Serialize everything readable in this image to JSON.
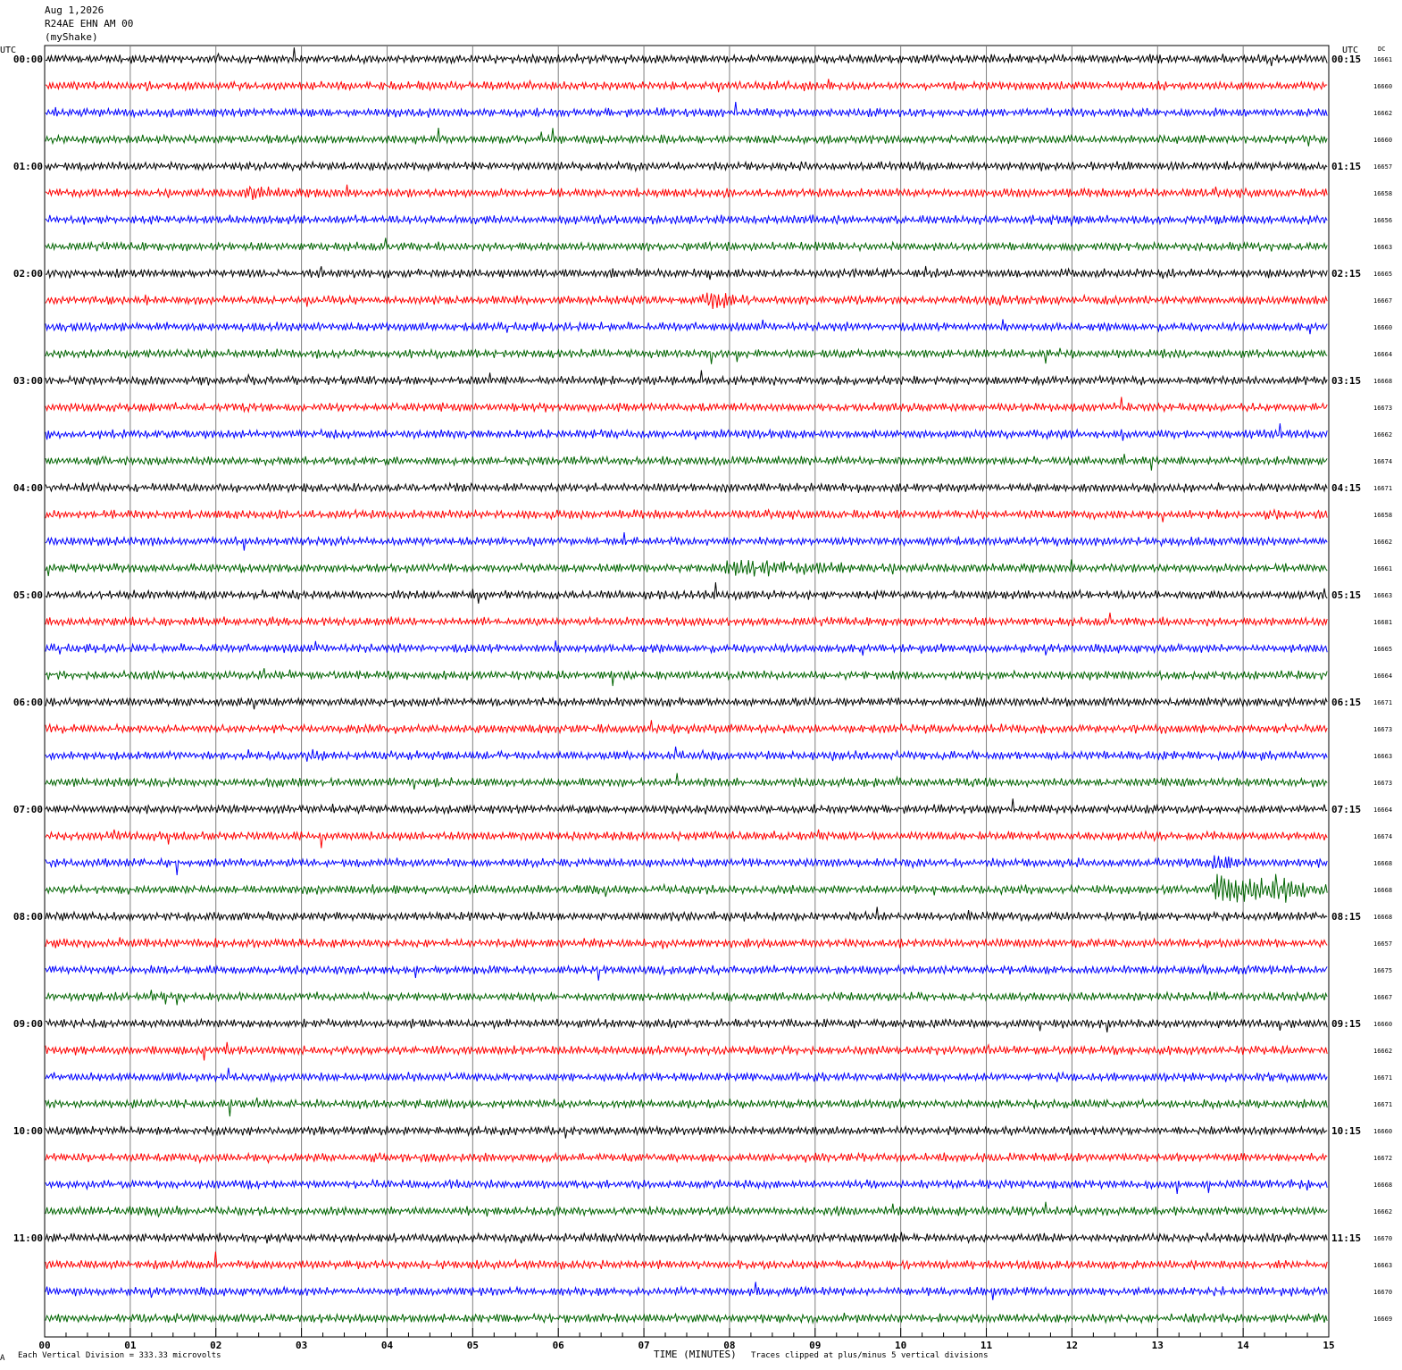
{
  "header": {
    "date": "Aug 1,2026",
    "station": "R24AE EHN AM 00",
    "network": "(myShake)"
  },
  "footer": {
    "scale_note": "Each Vertical Division =  333.33 microvolts",
    "clip_note": "Traces clipped at plus/minus 5 vertical divisions",
    "small_mark": "A"
  },
  "colors": {
    "trace_cycle": [
      "#000000",
      "#ff0000",
      "#0000ff",
      "#006400"
    ],
    "grid": "#808080"
  },
  "chart_data": {
    "type": "line",
    "subtype": "helicorder",
    "xlabel": "TIME (MINUTES)",
    "xlim": [
      0,
      15
    ],
    "x_ticks": [
      "00",
      "01",
      "02",
      "03",
      "04",
      "05",
      "06",
      "07",
      "08",
      "09",
      "10",
      "11",
      "12",
      "13",
      "14",
      "15"
    ],
    "left_axis_title": "UTC",
    "right_axis_title": "UTC",
    "dc_title": "DC",
    "row_minutes": 15,
    "row_labels_left": [
      "00:00",
      "",
      "",
      "",
      "01:00",
      "",
      "",
      "",
      "02:00",
      "",
      "",
      "",
      "03:00",
      "",
      "",
      "",
      "04:00",
      "",
      "",
      "",
      "05:00",
      "",
      "",
      "",
      "06:00",
      "",
      "",
      "",
      "07:00",
      "",
      "",
      "",
      "08:00",
      "",
      "",
      "",
      "09:00",
      "",
      "",
      "",
      "10:00",
      "",
      "",
      "",
      "11:00",
      "",
      "",
      ""
    ],
    "row_labels_right": [
      "00:15",
      "",
      "",
      "",
      "01:15",
      "",
      "",
      "",
      "02:15",
      "",
      "",
      "",
      "03:15",
      "",
      "",
      "",
      "04:15",
      "",
      "",
      "",
      "05:15",
      "",
      "",
      "",
      "06:15",
      "",
      "",
      "",
      "07:15",
      "",
      "",
      "",
      "08:15",
      "",
      "",
      "",
      "09:15",
      "",
      "",
      "",
      "10:15",
      "",
      "",
      "",
      "11:15",
      "",
      "",
      ""
    ],
    "dc_values": [
      "16661",
      "16660",
      "16662",
      "16660",
      "16657",
      "16658",
      "16656",
      "16663",
      "16665",
      "16667",
      "16660",
      "16664",
      "16668",
      "16673",
      "16662",
      "16674",
      "16671",
      "16658",
      "16662",
      "16661",
      "16663",
      "16681",
      "16665",
      "16664",
      "16671",
      "16673",
      "16663",
      "16673",
      "16664",
      "16674",
      "16668",
      "16668",
      "16668",
      "16657",
      "16675",
      "16667",
      "16660",
      "16662",
      "16671",
      "16671",
      "16660",
      "16672",
      "16668",
      "16662",
      "16670",
      "16663",
      "16670",
      "16669"
    ],
    "vertical_division_microvolts": 333.33,
    "clip_divisions": 5,
    "events": [
      {
        "row": 5,
        "minute": 2.4,
        "amp": 2.0,
        "dur": 0.5
      },
      {
        "row": 9,
        "minute": 7.75,
        "amp": 3.0,
        "dur": 0.5
      },
      {
        "row": 9,
        "minute": 1.2,
        "amp": 1.6,
        "dur": 0.2
      },
      {
        "row": 9,
        "minute": 11.1,
        "amp": 1.5,
        "dur": 0.4
      },
      {
        "row": 19,
        "minute": 8.0,
        "amp": 2.3,
        "dur": 2.2
      },
      {
        "row": 26,
        "minute": 3.1,
        "amp": 1.6,
        "dur": 0.5
      },
      {
        "row": 26,
        "minute": 3.9,
        "amp": 1.4,
        "dur": 0.4
      },
      {
        "row": 31,
        "minute": 13.7,
        "amp": 5.0,
        "dur": 1.6
      },
      {
        "row": 30,
        "minute": 13.7,
        "amp": 3.0,
        "dur": 0.4
      },
      {
        "row": 47,
        "minute": 13.4,
        "amp": 1.6,
        "dur": 0.6
      },
      {
        "row": 1,
        "minute": 8.7,
        "amp": 1.3,
        "dur": 0.3
      }
    ]
  }
}
